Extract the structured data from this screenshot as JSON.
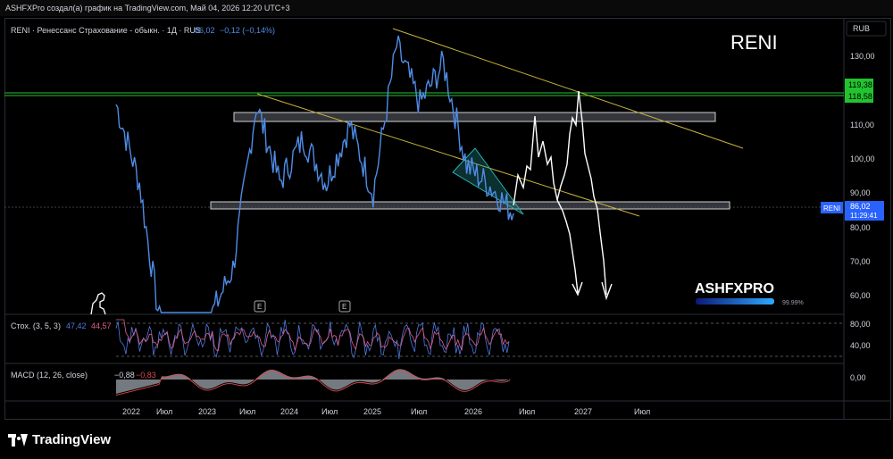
{
  "header": {
    "text": "ASHFXPro создал(а) график на TradingView.com, Май 04, 2026 12:20 UTC+3"
  },
  "legend": {
    "symbol": "RENI · Ренессанс Страхование - обыкн. · 1Д · RUS",
    "price": "86,02",
    "change": "−0,12 (−0,14%)"
  },
  "watermark": {
    "ticker": "RENI",
    "brand": "ASHFXPRO",
    "percent": "99.99%"
  },
  "currency": "RUB",
  "price_axis": [
    "130,00",
    "110,00",
    "100,00",
    "90,00",
    "80,00",
    "70,00",
    "60,00"
  ],
  "price_labels": {
    "green_top": "119,38",
    "green_bottom": "118,58",
    "current_symbol": "RENI",
    "current_price": "86,02",
    "countdown": "11:29:41"
  },
  "time_axis": [
    "2022",
    "Июл",
    "2023",
    "Июл",
    "2024",
    "Июл",
    "2025",
    "Июл",
    "2026",
    "Июл",
    "2027",
    "Июл"
  ],
  "stoch": {
    "title": "Стох. (3, 5, 3)",
    "k": "47,42",
    "d": "44,57",
    "axis": [
      "80,00",
      "40,00"
    ]
  },
  "macd": {
    "title": "MACD (12, 26, close)",
    "hist": "−0,88",
    "signal": "−0,83",
    "axis": [
      "0,00"
    ]
  },
  "earnings_markers": [
    "E",
    "E"
  ],
  "footer": {
    "brand": "TradingView"
  },
  "colors": {
    "price_line": "#4f8ce6",
    "projection": "#ffffff",
    "green_line": "#22c32e",
    "trendline": "#c8b23a",
    "stoch_k": "#4f79e0",
    "stoch_d": "#e05f8a",
    "macd_fill": "#8a8f98",
    "macd_signal": "#e0474c",
    "current_badge": "#2962ff"
  },
  "chart_data": {
    "type": "line",
    "title": "RENI · Ренессанс Страхование - обыкн. · 1Д · RUS",
    "ylim": [
      57,
      138
    ],
    "x": [
      "2022-01",
      "2022-04",
      "2022-07",
      "2022-10",
      "2023-01",
      "2023-04",
      "2023-07",
      "2023-10",
      "2024-01",
      "2024-04",
      "2024-07",
      "2024-10",
      "2025-01",
      "2025-04",
      "2025-07",
      "2025-10",
      "2026-01",
      "2026-04"
    ],
    "series": [
      {
        "values": [
          118,
          95,
          48,
          47,
          55,
          70,
          118,
          95,
          108,
          95,
          112,
          92,
          135,
          118,
          130,
          100,
          94,
          86
        ]
      }
    ],
    "horizontal_levels": [
      119.38,
      118.58,
      112,
      86
    ]
  }
}
